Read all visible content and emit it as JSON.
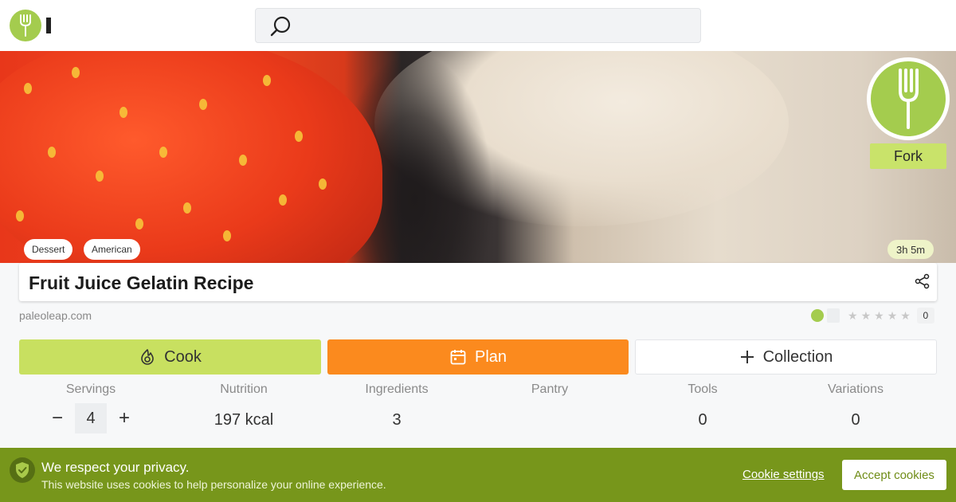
{
  "header": {
    "logo_icon": "fork-icon",
    "search_icon": "search-icon"
  },
  "hero": {
    "brand_name": "Fork",
    "tags": [
      "Dessert",
      "American"
    ],
    "time": "3h 5m"
  },
  "recipe": {
    "title": "Fruit Juice Gelatin Recipe",
    "source": "paleoleap.com",
    "rating_count": "0",
    "share_icon": "share-icon"
  },
  "actions": {
    "cook_label": "Cook",
    "plan_label": "Plan",
    "collection_label": "Collection"
  },
  "stats": {
    "servings_label": "Servings",
    "servings_value": "4",
    "nutrition_label": "Nutrition",
    "nutrition_value": "197 kcal",
    "ingredients_label": "Ingredients",
    "ingredients_value": "3",
    "pantry_label": "Pantry",
    "tools_label": "Tools",
    "tools_value": "0",
    "variations_label": "Variations",
    "variations_value": "0",
    "minus": "−",
    "plus": "+"
  },
  "cookie": {
    "title": "We respect your privacy.",
    "text": "This website uses cookies to help personalize your online experience.",
    "settings_label": "Cookie settings",
    "accept_label": "Accept cookies"
  },
  "colors": {
    "brand_green": "#a4cc4e",
    "cook_green": "#c8e060",
    "plan_orange": "#fb8a1e",
    "cookie_bar": "#77961b"
  }
}
